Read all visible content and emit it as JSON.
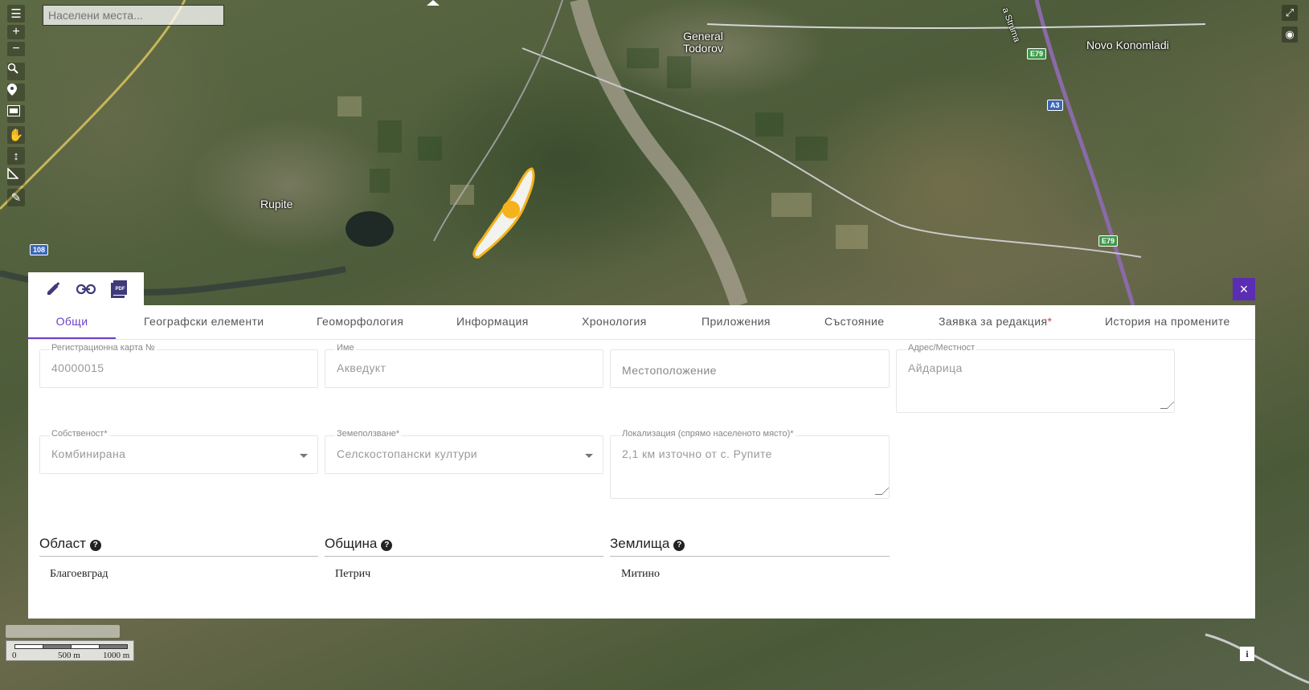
{
  "search": {
    "placeholder": "Населени места..."
  },
  "map": {
    "labels": [
      "General Todorov",
      "Novo Konomladi",
      "Rupite"
    ],
    "road_shields": [
      "E79",
      "A3",
      "E79",
      "108"
    ],
    "partial_road_label": "a Struma",
    "highlight_color": "#f5a623"
  },
  "toolbar": {
    "tools": [
      "layers-icon",
      "zoom-in-icon",
      "zoom-out-icon",
      "zoom-extent-icon",
      "marker-icon",
      "filmstrip-icon",
      "hand-icon",
      "vertical-measure-icon",
      "ruler-icon",
      "pencil-icon"
    ],
    "active_tool": "hand-icon",
    "zoom_in": "+",
    "zoom_out": "−"
  },
  "panel": {
    "actions": [
      "edit-icon",
      "link-icon",
      "pdf-icon"
    ],
    "tabs": [
      {
        "label": "Общи"
      },
      {
        "label": "Географски елементи"
      },
      {
        "label": "Геоморфология"
      },
      {
        "label": "Информация"
      },
      {
        "label": "Хронология"
      },
      {
        "label": "Приложения"
      },
      {
        "label": "Състояние"
      },
      {
        "label": "Заявка за редакция",
        "required": "*"
      },
      {
        "label": "История на промените"
      }
    ],
    "active_tab": "Общи",
    "fields": {
      "reg_card": {
        "label": "Регистрационна карта №",
        "value": "40000015"
      },
      "name": {
        "label": "Име",
        "value": "Акведукт"
      },
      "location": {
        "placeholder": "Местоположение"
      },
      "address": {
        "label": "Адрес/Местност",
        "value": "Айдарица"
      },
      "ownership": {
        "label": "Собственост*",
        "value": "Комбинирана"
      },
      "land_use": {
        "label": "Земеползване*",
        "value": "Селскостопански култури"
      },
      "localization": {
        "label": "Локализация (спрямо населеното място)*",
        "value": "2,1 км източно от с. Рупите"
      }
    },
    "sections": {
      "region": {
        "title": "Област",
        "help": "?",
        "value": "Благоевград"
      },
      "municipality": {
        "title": "Община",
        "help": "?",
        "value": "Петрич"
      },
      "lands": {
        "title": "Землища",
        "help": "?",
        "value": "Митино"
      }
    },
    "close": "×"
  },
  "scale": {
    "labels": [
      "0",
      "500 m",
      "1000 m"
    ]
  },
  "info_button": "i",
  "accent_color": "#6a3fc7"
}
